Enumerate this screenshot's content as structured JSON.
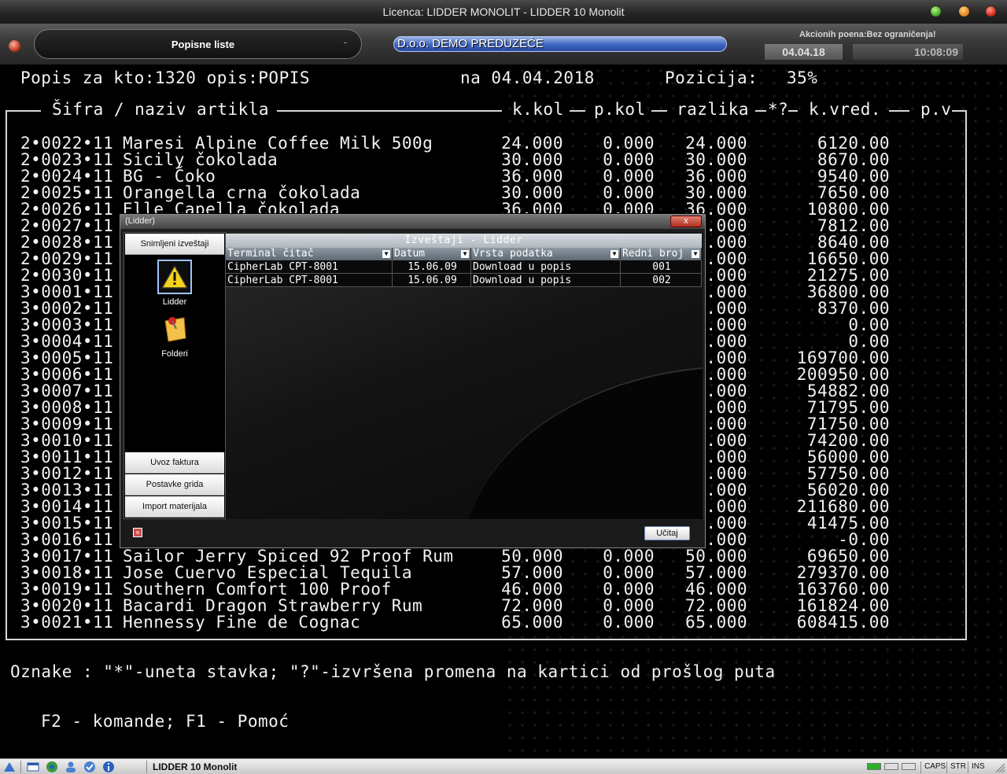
{
  "window": {
    "title": "Licenca: LIDDER MONOLIT - LIDDER 10 Monolit"
  },
  "header": {
    "module_label": "Popisne liste",
    "module_dash": "-",
    "company": "D.o.o. DEMO PREDUZEĆE",
    "promo": "Akcionih poena:Bez ograničenja!",
    "date": "04.04.18",
    "time": "10:08:09"
  },
  "terminal": {
    "header_left": "Popis za kto:1320 opis:POPIS",
    "header_date": "na 04.04.2018",
    "header_position_label": "Pozicija:",
    "header_position_value": "35%",
    "col_sifra": "Šifra / naziv artikla",
    "col_kkol": "k.kol",
    "col_pkol": "p.kol",
    "col_razlika": "razlika",
    "col_marks": "*?",
    "col_kvred": "k.vred.",
    "col_pv": "p.v",
    "rows": [
      {
        "code": "2•0022•11",
        "name": "Maresi Alpine Coffee Milk 500g",
        "kkol": "24.000",
        "pkol": "0.000",
        "razlika": "24.000",
        "kvred": "6120.00"
      },
      {
        "code": "2•0023•11",
        "name": "Sicily čokolada",
        "kkol": "30.000",
        "pkol": "0.000",
        "razlika": "30.000",
        "kvred": "8670.00"
      },
      {
        "code": "2•0024•11",
        "name": "BG - Čoko",
        "kkol": "36.000",
        "pkol": "0.000",
        "razlika": "36.000",
        "kvred": "9540.00"
      },
      {
        "code": "2•0025•11",
        "name": "Orangella crna čokolada",
        "kkol": "30.000",
        "pkol": "0.000",
        "razlika": "30.000",
        "kvred": "7650.00"
      },
      {
        "code": "2•0026•11",
        "name": "Elle Capella čokolada",
        "kkol": "36.000",
        "pkol": "0.000",
        "razlika": "36.000",
        "kvred": "10800.00"
      },
      {
        "code": "2•0027•11",
        "name": "",
        "kkol": "",
        "pkol": "",
        "razlika": ".000",
        "kvred": "7812.00"
      },
      {
        "code": "2•0028•11",
        "name": "",
        "kkol": "",
        "pkol": "",
        "razlika": ".000",
        "kvred": "8640.00"
      },
      {
        "code": "2•0029•11",
        "name": "",
        "kkol": "",
        "pkol": "",
        "razlika": ".000",
        "kvred": "16650.00"
      },
      {
        "code": "2•0030•11",
        "name": "",
        "kkol": "",
        "pkol": "",
        "razlika": ".000",
        "kvred": "21275.00"
      },
      {
        "code": "3•0001•11",
        "name": "",
        "kkol": "",
        "pkol": "",
        "razlika": ".000",
        "kvred": "36800.00"
      },
      {
        "code": "3•0002•11",
        "name": "",
        "kkol": "",
        "pkol": "",
        "razlika": ".000",
        "kvred": "8370.00"
      },
      {
        "code": "3•0003•11",
        "name": "",
        "kkol": "",
        "pkol": "",
        "razlika": ".000",
        "kvred": "0.00"
      },
      {
        "code": "3•0004•11",
        "name": "",
        "kkol": "",
        "pkol": "",
        "razlika": ".000",
        "kvred": "0.00"
      },
      {
        "code": "3•0005•11",
        "name": "",
        "kkol": "",
        "pkol": "",
        "razlika": ".000",
        "kvred": "169700.00"
      },
      {
        "code": "3•0006•11",
        "name": "",
        "kkol": "",
        "pkol": "",
        "razlika": ".000",
        "kvred": "200950.00"
      },
      {
        "code": "3•0007•11",
        "name": "",
        "kkol": "",
        "pkol": "",
        "razlika": ".000",
        "kvred": "54882.00"
      },
      {
        "code": "3•0008•11",
        "name": "",
        "kkol": "",
        "pkol": "",
        "razlika": ".000",
        "kvred": "71795.00"
      },
      {
        "code": "3•0009•11",
        "name": "",
        "kkol": "",
        "pkol": "",
        "razlika": ".000",
        "kvred": "71750.00"
      },
      {
        "code": "3•0010•11",
        "name": "",
        "kkol": "",
        "pkol": "",
        "razlika": ".000",
        "kvred": "74200.00"
      },
      {
        "code": "3•0011•11",
        "name": "",
        "kkol": "",
        "pkol": "",
        "razlika": ".000",
        "kvred": "56000.00"
      },
      {
        "code": "3•0012•11",
        "name": "",
        "kkol": "",
        "pkol": "",
        "razlika": ".000",
        "kvred": "57750.00"
      },
      {
        "code": "3•0013•11",
        "name": "",
        "kkol": "",
        "pkol": "",
        "razlika": ".000",
        "kvred": "56020.00"
      },
      {
        "code": "3•0014•11",
        "name": "",
        "kkol": "",
        "pkol": "",
        "razlika": ".000",
        "kvred": "211680.00"
      },
      {
        "code": "3•0015•11",
        "name": "",
        "kkol": "",
        "pkol": "",
        "razlika": ".000",
        "kvred": "41475.00"
      },
      {
        "code": "3•0016•11",
        "name": "",
        "kkol": "",
        "pkol": "",
        "razlika": ".000",
        "kvred": "-0.00"
      },
      {
        "code": "3•0017•11",
        "name": "Sailor Jerry Spiced 92 Proof Rum",
        "kkol": "50.000",
        "pkol": "0.000",
        "razlika": "50.000",
        "kvred": "69650.00"
      },
      {
        "code": "3•0018•11",
        "name": "Jose Cuervo Especial Tequila",
        "kkol": "57.000",
        "pkol": "0.000",
        "razlika": "57.000",
        "kvred": "279370.00"
      },
      {
        "code": "3•0019•11",
        "name": "Southern Comfort 100 Proof",
        "kkol": "46.000",
        "pkol": "0.000",
        "razlika": "46.000",
        "kvred": "163760.00"
      },
      {
        "code": "3•0020•11",
        "name": "Bacardi Dragon Strawberry Rum",
        "kkol": "72.000",
        "pkol": "0.000",
        "razlika": "72.000",
        "kvred": "161824.00"
      },
      {
        "code": "3•0021•11",
        "name": "Hennessy Fine de Cognac",
        "kkol": "65.000",
        "pkol": "0.000",
        "razlika": "65.000",
        "kvred": "608415.00"
      }
    ],
    "legend": "Oznake : \"*\"-uneta stavka; \"?\"-izvršena promena na kartici od prošlog puta",
    "fkeys": "F2 - komande; F1 - Pomoć"
  },
  "dialog": {
    "title": "(Lidder)",
    "close_label": "x",
    "side": {
      "top_button": "Snimljeni izveštaji",
      "icon1_label": "Lidder",
      "icon2_label": "Folderi",
      "buttons": [
        "Uvoz faktura",
        "Postavke grida",
        "Import materijala"
      ]
    },
    "grid": {
      "caption": "Izveštaji - Lidder",
      "headers": [
        "Terminal čitač",
        "Datum",
        "Vrsta podatka",
        "Redni broj"
      ],
      "rows": [
        [
          "CipherLab CPT-8001",
          "15.06.09",
          "Download u popis",
          "001"
        ],
        [
          "CipherLab CPT-8001",
          "15.06.09",
          "Download u popis",
          "002"
        ]
      ]
    },
    "load_button": "Učitaj"
  },
  "taskbar": {
    "app": "LIDDER 10 Monolit",
    "indicators": [
      "CAPS",
      "STR",
      "INS"
    ]
  }
}
